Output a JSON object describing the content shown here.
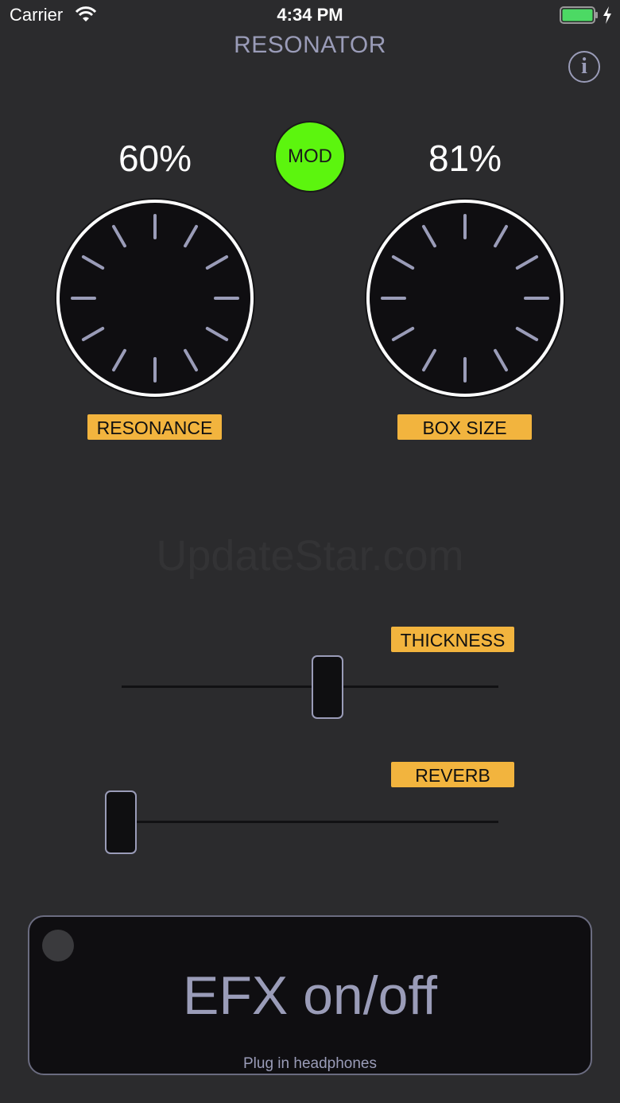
{
  "status_bar": {
    "carrier": "Carrier",
    "time": "4:34 PM",
    "wifi_icon": "wifi-icon",
    "battery_icon": "battery-charging-icon",
    "battery_level": 1.0,
    "battery_color": "#4cd964"
  },
  "header": {
    "title": "RESONATOR",
    "info_label": "i"
  },
  "knobs": [
    {
      "label": "RESONANCE",
      "value_text": "60%",
      "value": 0.6
    },
    {
      "label": "BOX SIZE",
      "value_text": "81%",
      "value": 0.81
    }
  ],
  "mod_button": {
    "label": "MOD",
    "color": "#5cf50e"
  },
  "watermark": "UpdateStar.com",
  "sliders": [
    {
      "label": "THICKNESS",
      "value": 0.55
    },
    {
      "label": "REVERB",
      "value": 0.0
    }
  ],
  "efx_button": {
    "label": "EFX on/off",
    "hint": "Plug in headphones",
    "state": "off"
  },
  "colors": {
    "background": "#2b2b2d",
    "accent_label": "#f2b43e",
    "text_muted": "#9a9cb8",
    "knob_face": "#0f0e11"
  }
}
